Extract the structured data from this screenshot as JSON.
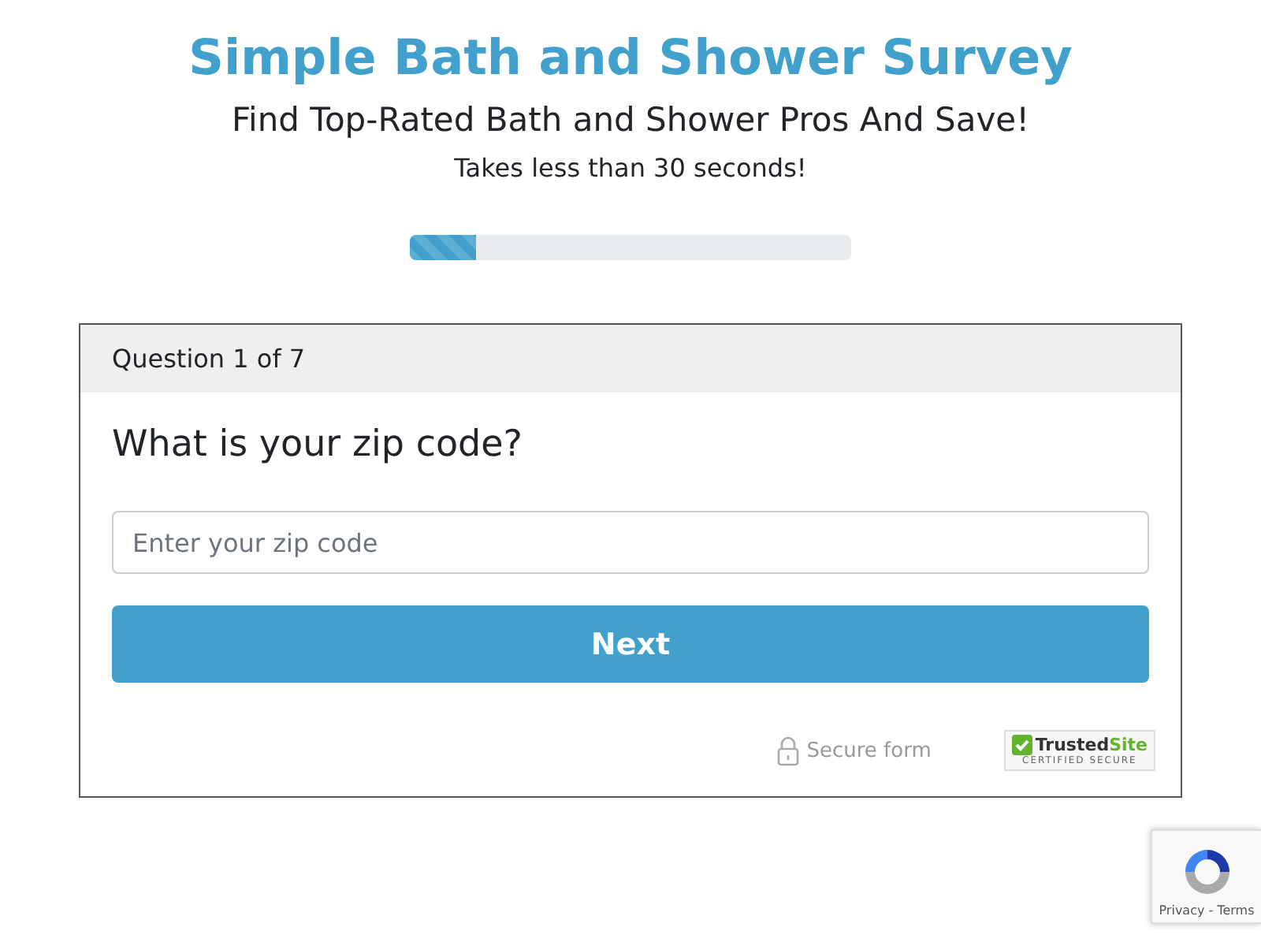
{
  "header": {
    "title": "Simple Bath and Shower Survey",
    "subtitle": "Find Top-Rated Bath and Shower Pros And Save!",
    "note": "Takes less than 30 seconds!"
  },
  "progress": {
    "level": 0.15
  },
  "card": {
    "step": "Question 1 of 7",
    "question": "What is your zip code?",
    "field": {
      "placeholder": "Enter your zip code"
    },
    "button": "Next",
    "secure": "Secure form",
    "trust": {
      "name": "Trusted",
      "accent": "Site",
      "caption": "CERTIFIED SECURE"
    }
  },
  "recaptcha": {
    "links": "Privacy - Terms"
  }
}
